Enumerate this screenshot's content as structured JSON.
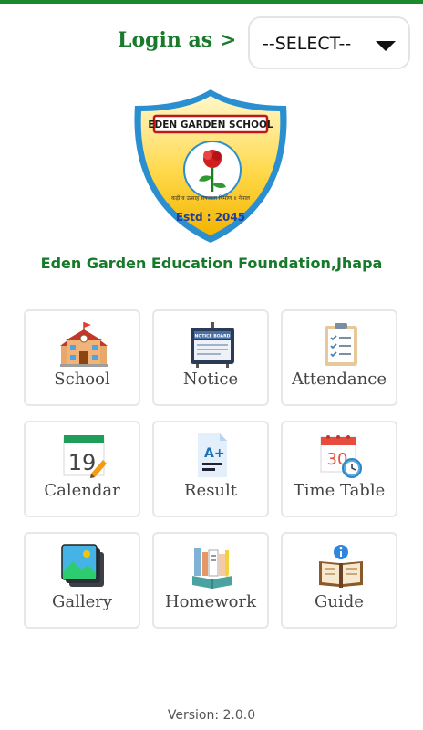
{
  "header": {
    "login_label": "Login as >",
    "select_value": "--SELECT--"
  },
  "logo": {
    "banner": "EDEN GARDEN SCHOOL",
    "motto": "कड़ी व उत्साह सफलता निर्माण ॥ नेपाल",
    "estd": "Estd : 2045"
  },
  "foundation_name": "Eden Garden Education Foundation,Jhapa",
  "menu": [
    {
      "label": "School",
      "icon": "school-building-icon"
    },
    {
      "label": "Notice",
      "icon": "notice-board-icon"
    },
    {
      "label": "Attendance",
      "icon": "clipboard-checklist-icon"
    },
    {
      "label": "Calendar",
      "icon": "calendar-icon",
      "day": "19"
    },
    {
      "label": "Result",
      "icon": "result-document-icon",
      "grade": "A+"
    },
    {
      "label": "Time Table",
      "icon": "timetable-calendar-icon",
      "day": "30"
    },
    {
      "label": "Gallery",
      "icon": "gallery-images-icon"
    },
    {
      "label": "Homework",
      "icon": "homework-books-icon"
    },
    {
      "label": "Guide",
      "icon": "guide-book-icon"
    }
  ],
  "notice_icon_text": "NOTICE BOARD",
  "version": "Version: 2.0.0",
  "colors": {
    "brand_green": "#1a7a2c",
    "topbar": "#1b8a2a",
    "tile_border": "#e7e7e7"
  }
}
